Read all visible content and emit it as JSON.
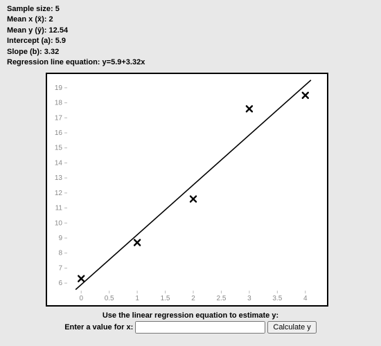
{
  "stats": {
    "sample_size_label": "Sample size:",
    "sample_size_value": "5",
    "mean_x_label": "Mean x (x̄):",
    "mean_x_value": "2",
    "mean_y_label": "Mean y (ȳ):",
    "mean_y_value": "12.54",
    "intercept_label": "Intercept (a):",
    "intercept_value": "5.9",
    "slope_label": "Slope (b):",
    "slope_value": "3.32",
    "equation_label": "Regression line equation:",
    "equation_value": "y=5.9+3.32x"
  },
  "chart_data": {
    "type": "scatter",
    "points": [
      {
        "x": 0,
        "y": 6.3
      },
      {
        "x": 1,
        "y": 8.7
      },
      {
        "x": 2,
        "y": 11.6
      },
      {
        "x": 3,
        "y": 17.6
      },
      {
        "x": 4,
        "y": 18.5
      }
    ],
    "regression": {
      "intercept": 5.9,
      "slope": 3.32
    },
    "x_ticks": [
      0,
      0.5,
      1,
      1.5,
      2,
      2.5,
      3,
      3.5,
      4
    ],
    "y_ticks": [
      6,
      7,
      8,
      9,
      10,
      11,
      12,
      13,
      14,
      15,
      16,
      17,
      18,
      19
    ],
    "xlim": [
      -0.25,
      4.25
    ],
    "ylim": [
      5.5,
      19.5
    ]
  },
  "form": {
    "heading": "Use the linear regression equation to estimate y:",
    "x_label": "Enter a value for x:",
    "x_value": "",
    "x_placeholder": "",
    "button": "Calculate y"
  }
}
